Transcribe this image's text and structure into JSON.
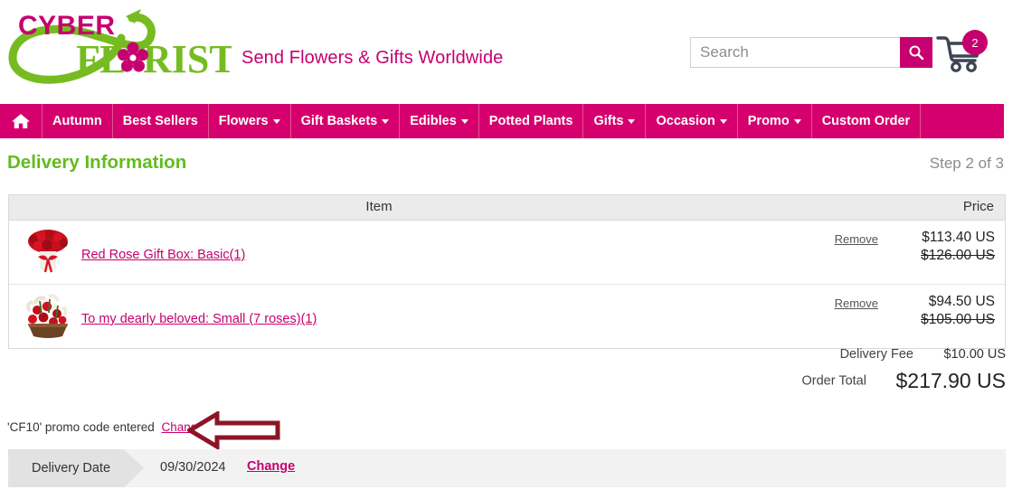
{
  "brand": {
    "logo_line1": "CYBER",
    "logo_line2": "FLORIST",
    "tagline": "Send Flowers & Gifts Worldwide",
    "accent_pink": "#c6006f",
    "accent_green": "#63bb20",
    "nav_pink": "#d5006d"
  },
  "search": {
    "placeholder": "Search",
    "value": "",
    "icon": "search-icon"
  },
  "cart": {
    "icon": "shopping-cart-icon",
    "count": "2"
  },
  "nav": {
    "home_icon": "home-icon",
    "items": [
      {
        "label": "Autumn",
        "dropdown": false
      },
      {
        "label": "Best Sellers",
        "dropdown": false
      },
      {
        "label": "Flowers",
        "dropdown": true
      },
      {
        "label": "Gift Baskets",
        "dropdown": true
      },
      {
        "label": "Edibles",
        "dropdown": true
      },
      {
        "label": "Potted Plants",
        "dropdown": false
      },
      {
        "label": "Gifts",
        "dropdown": true
      },
      {
        "label": "Occasion",
        "dropdown": true
      },
      {
        "label": "Promo",
        "dropdown": true
      },
      {
        "label": "Custom Order",
        "dropdown": false
      }
    ]
  },
  "page": {
    "title": "Delivery Information",
    "step": "Step 2 of 3"
  },
  "table": {
    "header_item": "Item",
    "header_price": "Price",
    "rows": [
      {
        "name": "Red Rose Gift Box: Basic(1)",
        "thumb": "red-roses-gift-box-thumbnail",
        "remove_label": "Remove",
        "price": "$113.40 US",
        "price_old": "$126.00 US"
      },
      {
        "name": "To my dearly beloved: Small (7 roses)(1)",
        "thumb": "red-roses-white-lilies-basket-thumbnail",
        "remove_label": "Remove",
        "price": "$94.50 US",
        "price_old": "$105.00 US"
      }
    ]
  },
  "totals": {
    "delivery_fee_label": "Delivery Fee",
    "delivery_fee_value": "$10.00 US",
    "order_total_label": "Order Total",
    "order_total_value": "$217.90 US"
  },
  "promo": {
    "text": "'CF10' promo code entered",
    "change_label": "Change",
    "annotation_icon": "left-arrow-annotation",
    "annotation_color": "#8b1526"
  },
  "delivery": {
    "label": "Delivery Date",
    "date": "09/30/2024",
    "change_label": "Change"
  }
}
